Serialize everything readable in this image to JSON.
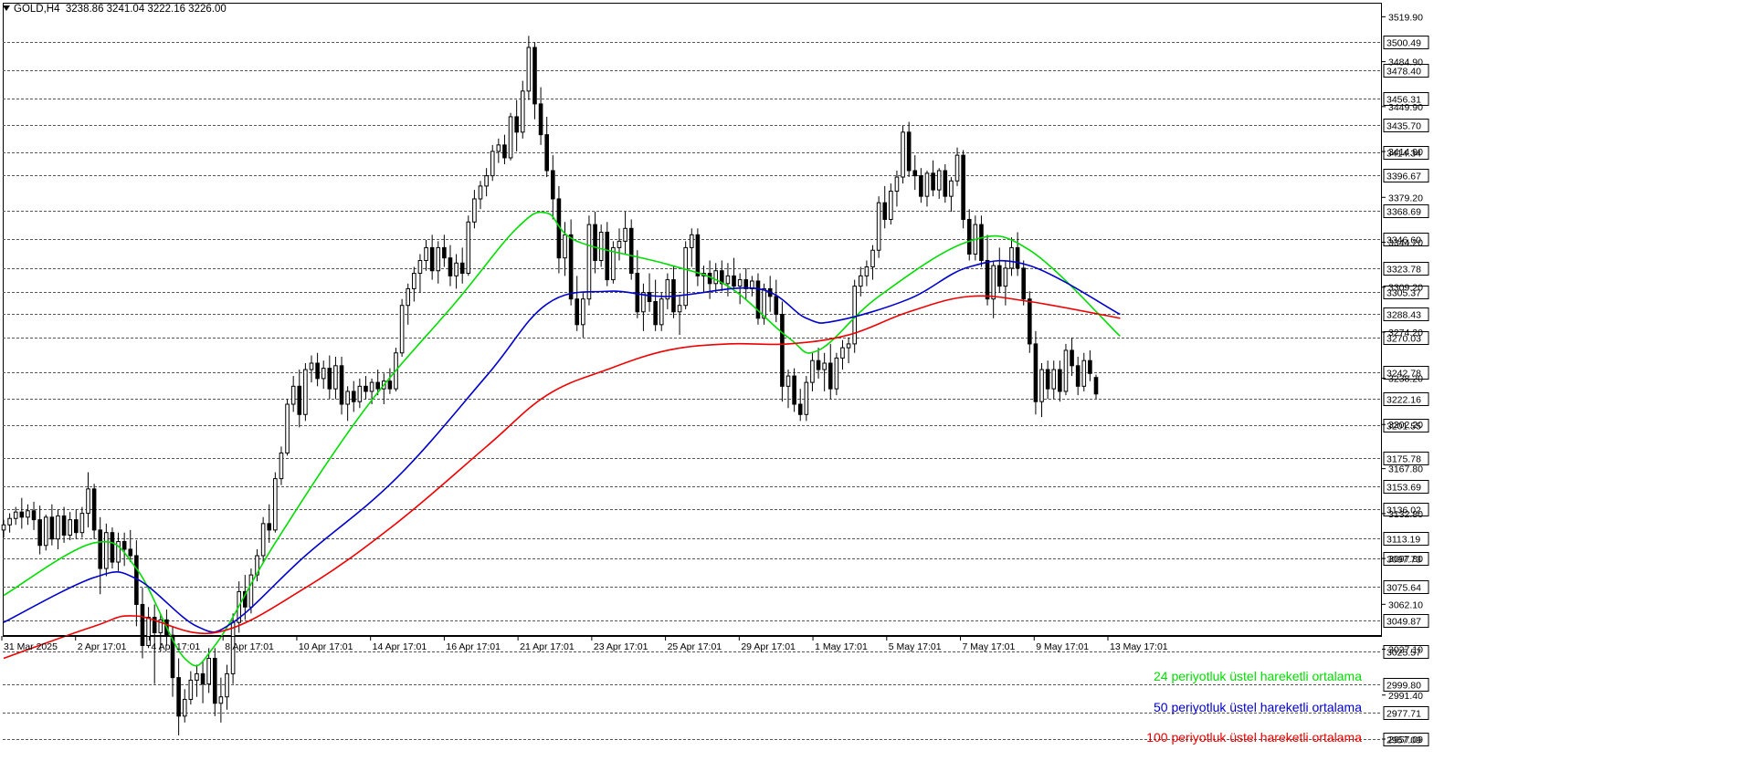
{
  "header": {
    "symbol": "GOLD,H4",
    "ohlc": "3238.86 3241.04 3222.16 3226.00"
  },
  "legend": [
    {
      "label": "24 periyotluk üstel hareketli ortalama",
      "color": "#00dd00"
    },
    {
      "label": "50 periyotluk üstel hareketli ortalama",
      "color": "#0000cc"
    },
    {
      "label": "100 periyotluk üstel hareketli ortalama",
      "color": "#ee0000"
    }
  ],
  "chart_data": {
    "type": "candlestick",
    "instrument": "GOLD",
    "timeframe": "H4",
    "ylim": [
      2950.0,
      3523.0
    ],
    "x_ticks": [
      "31 Mar 2025",
      "2 Apr 17:01",
      "4 Apr 17:01",
      "8 Apr 17:01",
      "10 Apr 17:01",
      "14 Apr 17:01",
      "16 Apr 17:01",
      "21 Apr 17:01",
      "23 Apr 17:01",
      "25 Apr 17:01",
      "29 Apr 17:01",
      "1 May 17:01",
      "5 May 17:01",
      "7 May 17:01",
      "9 May 17:01",
      "13 May 17:01"
    ],
    "y_ticks": [
      3519.9,
      3484.9,
      3449.9,
      3414.9,
      3379.2,
      3344.2,
      3309.2,
      3274.2,
      3238.2,
      3202.2,
      3167.8,
      3132.8,
      3097.8,
      3062.1,
      3027.1,
      2991.4,
      2957.09
    ],
    "price_levels": [
      3500.49,
      3478.4,
      3456.31,
      3435.7,
      3414.34,
      3396.67,
      3368.69,
      3346.6,
      3323.78,
      3305.37,
      3288.43,
      3270.03,
      3242.78,
      3222.16,
      3201.55,
      3175.78,
      3153.69,
      3136.02,
      3113.19,
      3097.73,
      3075.64,
      3049.87,
      3025.57,
      2999.8,
      2977.71,
      2957.09
    ],
    "current_price": 3222.16,
    "candles": [
      [
        3120,
        3128,
        3114,
        3124
      ],
      [
        3124,
        3133,
        3118,
        3129
      ],
      [
        3129,
        3138,
        3124,
        3134
      ],
      [
        3134,
        3145,
        3121,
        3130
      ],
      [
        3130,
        3140,
        3124,
        3135
      ],
      [
        3135,
        3142,
        3120,
        3128
      ],
      [
        3128,
        3139,
        3101,
        3108
      ],
      [
        3108,
        3132,
        3104,
        3130
      ],
      [
        3130,
        3140,
        3108,
        3113
      ],
      [
        3113,
        3136,
        3105,
        3131
      ],
      [
        3131,
        3138,
        3110,
        3116
      ],
      [
        3116,
        3134,
        3112,
        3128
      ],
      [
        3128,
        3136,
        3113,
        3118
      ],
      [
        3118,
        3138,
        3114,
        3133
      ],
      [
        3133,
        3165,
        3122,
        3152
      ],
      [
        3152,
        3156,
        3113,
        3120
      ],
      [
        3120,
        3130,
        3070,
        3090
      ],
      [
        3090,
        3125,
        3084,
        3118
      ],
      [
        3118,
        3122,
        3090,
        3095
      ],
      [
        3095,
        3118,
        3088,
        3111
      ],
      [
        3111,
        3118,
        3092,
        3105
      ],
      [
        3105,
        3120,
        3095,
        3100
      ],
      [
        3100,
        3112,
        3045,
        3062
      ],
      [
        3062,
        3075,
        3020,
        3030
      ],
      [
        3030,
        3060,
        3028,
        3052
      ],
      [
        3052,
        3062,
        3000,
        3040
      ],
      [
        3040,
        3055,
        3025,
        3050
      ],
      [
        3050,
        3058,
        3030,
        3038
      ],
      [
        3038,
        3045,
        2990,
        3005
      ],
      [
        3005,
        3020,
        2960,
        2975
      ],
      [
        2975,
        2996,
        2970,
        2988
      ],
      [
        2988,
        3010,
        2984,
        3003
      ],
      [
        3003,
        3015,
        2990,
        3008
      ],
      [
        3008,
        3018,
        2985,
        3000
      ],
      [
        3000,
        3028,
        2993,
        3020
      ],
      [
        3020,
        3028,
        2975,
        2985
      ],
      [
        2985,
        3005,
        2970,
        2990
      ],
      [
        2990,
        3015,
        2980,
        3008
      ],
      [
        3008,
        3055,
        3000,
        3048
      ],
      [
        3048,
        3080,
        3040,
        3072
      ],
      [
        3072,
        3085,
        3050,
        3060
      ],
      [
        3060,
        3090,
        3055,
        3085
      ],
      [
        3085,
        3105,
        3080,
        3100
      ],
      [
        3100,
        3130,
        3095,
        3125
      ],
      [
        3125,
        3140,
        3110,
        3120
      ],
      [
        3120,
        3165,
        3118,
        3160
      ],
      [
        3160,
        3185,
        3155,
        3180
      ],
      [
        3180,
        3222,
        3178,
        3218
      ],
      [
        3218,
        3240,
        3212,
        3232
      ],
      [
        3232,
        3245,
        3200,
        3210
      ],
      [
        3210,
        3250,
        3205,
        3245
      ],
      [
        3245,
        3256,
        3235,
        3250
      ],
      [
        3250,
        3258,
        3232,
        3238
      ],
      [
        3238,
        3252,
        3230,
        3246
      ],
      [
        3246,
        3256,
        3222,
        3230
      ],
      [
        3230,
        3255,
        3222,
        3248
      ],
      [
        3248,
        3255,
        3210,
        3218
      ],
      [
        3218,
        3232,
        3205,
        3228
      ],
      [
        3228,
        3236,
        3212,
        3220
      ],
      [
        3220,
        3238,
        3215,
        3232
      ],
      [
        3232,
        3240,
        3222,
        3228
      ],
      [
        3228,
        3238,
        3218,
        3235
      ],
      [
        3235,
        3245,
        3225,
        3230
      ],
      [
        3230,
        3242,
        3218,
        3236
      ],
      [
        3236,
        3246,
        3226,
        3230
      ],
      [
        3230,
        3262,
        3228,
        3258
      ],
      [
        3258,
        3300,
        3255,
        3295
      ],
      [
        3295,
        3312,
        3280,
        3308
      ],
      [
        3308,
        3325,
        3298,
        3320
      ],
      [
        3320,
        3335,
        3305,
        3330
      ],
      [
        3330,
        3346,
        3322,
        3340
      ],
      [
        3340,
        3350,
        3315,
        3322
      ],
      [
        3322,
        3345,
        3312,
        3340
      ],
      [
        3340,
        3350,
        3325,
        3332
      ],
      [
        3332,
        3342,
        3310,
        3318
      ],
      [
        3318,
        3335,
        3308,
        3328
      ],
      [
        3328,
        3340,
        3312,
        3320
      ],
      [
        3320,
        3365,
        3318,
        3360
      ],
      [
        3360,
        3385,
        3355,
        3378
      ],
      [
        3378,
        3392,
        3370,
        3388
      ],
      [
        3388,
        3402,
        3380,
        3396
      ],
      [
        3396,
        3420,
        3392,
        3415
      ],
      [
        3415,
        3425,
        3406,
        3420
      ],
      [
        3420,
        3428,
        3405,
        3410
      ],
      [
        3410,
        3445,
        3408,
        3442
      ],
      [
        3442,
        3455,
        3415,
        3430
      ],
      [
        3430,
        3470,
        3425,
        3462
      ],
      [
        3462,
        3505,
        3455,
        3496
      ],
      [
        3496,
        3500,
        3440,
        3452
      ],
      [
        3452,
        3465,
        3420,
        3428
      ],
      [
        3428,
        3442,
        3395,
        3400
      ],
      [
        3400,
        3412,
        3362,
        3378
      ],
      [
        3378,
        3388,
        3320,
        3332
      ],
      [
        3332,
        3360,
        3318,
        3350
      ],
      [
        3350,
        3362,
        3295,
        3300
      ],
      [
        3300,
        3318,
        3275,
        3280
      ],
      [
        3280,
        3305,
        3270,
        3300
      ],
      [
        3300,
        3365,
        3295,
        3358
      ],
      [
        3358,
        3368,
        3320,
        3330
      ],
      [
        3330,
        3358,
        3325,
        3352
      ],
      [
        3352,
        3360,
        3310,
        3315
      ],
      [
        3315,
        3345,
        3312,
        3340
      ],
      [
        3340,
        3355,
        3330,
        3345
      ],
      [
        3345,
        3368,
        3335,
        3355
      ],
      [
        3355,
        3362,
        3315,
        3320
      ],
      [
        3320,
        3338,
        3285,
        3290
      ],
      [
        3290,
        3312,
        3275,
        3305
      ],
      [
        3305,
        3320,
        3290,
        3298
      ],
      [
        3298,
        3315,
        3275,
        3280
      ],
      [
        3280,
        3305,
        3275,
        3300
      ],
      [
        3300,
        3320,
        3292,
        3315
      ],
      [
        3315,
        3326,
        3285,
        3290
      ],
      [
        3290,
        3302,
        3272,
        3295
      ],
      [
        3295,
        3345,
        3292,
        3340
      ],
      [
        3340,
        3355,
        3325,
        3350
      ],
      [
        3350,
        3355,
        3310,
        3318
      ],
      [
        3318,
        3326,
        3305,
        3320
      ],
      [
        3320,
        3330,
        3300,
        3312
      ],
      [
        3312,
        3328,
        3305,
        3322
      ],
      [
        3322,
        3330,
        3306,
        3312
      ],
      [
        3312,
        3328,
        3302,
        3318
      ],
      [
        3318,
        3332,
        3306,
        3310
      ],
      [
        3310,
        3320,
        3296,
        3315
      ],
      [
        3315,
        3324,
        3300,
        3308
      ],
      [
        3308,
        3318,
        3302,
        3314
      ],
      [
        3314,
        3320,
        3280,
        3285
      ],
      [
        3285,
        3312,
        3280,
        3308
      ],
      [
        3308,
        3318,
        3290,
        3302
      ],
      [
        3302,
        3315,
        3282,
        3288
      ],
      [
        3288,
        3298,
        3220,
        3232
      ],
      [
        3232,
        3245,
        3215,
        3240
      ],
      [
        3240,
        3246,
        3212,
        3218
      ],
      [
        3218,
        3230,
        3205,
        3210
      ],
      [
        3210,
        3240,
        3205,
        3235
      ],
      [
        3235,
        3258,
        3228,
        3252
      ],
      [
        3252,
        3262,
        3238,
        3245
      ],
      [
        3245,
        3258,
        3228,
        3250
      ],
      [
        3250,
        3265,
        3222,
        3230
      ],
      [
        3230,
        3258,
        3225,
        3254
      ],
      [
        3254,
        3268,
        3245,
        3262
      ],
      [
        3262,
        3270,
        3250,
        3265
      ],
      [
        3265,
        3315,
        3258,
        3310
      ],
      [
        3310,
        3325,
        3302,
        3318
      ],
      [
        3318,
        3330,
        3310,
        3325
      ],
      [
        3325,
        3342,
        3315,
        3338
      ],
      [
        3338,
        3380,
        3332,
        3375
      ],
      [
        3375,
        3388,
        3355,
        3362
      ],
      [
        3362,
        3390,
        3358,
        3384
      ],
      [
        3384,
        3400,
        3372,
        3395
      ],
      [
        3395,
        3435,
        3390,
        3430
      ],
      [
        3430,
        3438,
        3395,
        3400
      ],
      [
        3400,
        3412,
        3385,
        3396
      ],
      [
        3396,
        3402,
        3375,
        3380
      ],
      [
        3380,
        3400,
        3372,
        3398
      ],
      [
        3398,
        3408,
        3380,
        3385
      ],
      [
        3385,
        3402,
        3378,
        3400
      ],
      [
        3400,
        3405,
        3375,
        3380
      ],
      [
        3380,
        3395,
        3368,
        3392
      ],
      [
        3392,
        3418,
        3388,
        3412
      ],
      [
        3412,
        3416,
        3355,
        3362
      ],
      [
        3362,
        3370,
        3330,
        3335
      ],
      [
        3335,
        3365,
        3330,
        3358
      ],
      [
        3358,
        3365,
        3325,
        3330
      ],
      [
        3330,
        3350,
        3295,
        3300
      ],
      [
        3300,
        3330,
        3285,
        3326
      ],
      [
        3326,
        3340,
        3305,
        3310
      ],
      [
        3310,
        3330,
        3295,
        3324
      ],
      [
        3324,
        3348,
        3318,
        3340
      ],
      [
        3340,
        3352,
        3318,
        3324
      ],
      [
        3324,
        3330,
        3295,
        3300
      ],
      [
        3300,
        3306,
        3258,
        3265
      ],
      [
        3265,
        3275,
        3210,
        3220
      ],
      [
        3220,
        3250,
        3208,
        3245
      ],
      [
        3245,
        3252,
        3222,
        3230
      ],
      [
        3230,
        3252,
        3222,
        3245
      ],
      [
        3245,
        3252,
        3220,
        3228
      ],
      [
        3228,
        3265,
        3225,
        3260
      ],
      [
        3260,
        3270,
        3240,
        3248
      ],
      [
        3248,
        3255,
        3225,
        3232
      ],
      [
        3232,
        3258,
        3228,
        3252
      ],
      [
        3252,
        3260,
        3236,
        3242
      ],
      [
        3238.86,
        3241.04,
        3222.16,
        3226.0
      ]
    ],
    "series": [
      {
        "name": "24 periyotluk üstel hareketli ortalama",
        "color": "#00dd00",
        "period": 24,
        "points": [
          [
            0,
            3069
          ],
          [
            15,
            3110
          ],
          [
            22,
            3090
          ],
          [
            30,
            3020
          ],
          [
            35,
            3030
          ],
          [
            45,
            3110
          ],
          [
            60,
            3215
          ],
          [
            75,
            3298
          ],
          [
            85,
            3355
          ],
          [
            90,
            3367
          ],
          [
            95,
            3345
          ],
          [
            110,
            3327
          ],
          [
            120,
            3310
          ],
          [
            130,
            3270
          ],
          [
            135,
            3260
          ],
          [
            145,
            3302
          ],
          [
            160,
            3345
          ],
          [
            170,
            3338
          ],
          [
            185,
            3271
          ]
        ]
      },
      {
        "name": "50 periyotluk üstel hareketli ortalama",
        "color": "#0000cc",
        "period": 50,
        "points": [
          [
            0,
            3048
          ],
          [
            15,
            3083
          ],
          [
            22,
            3082
          ],
          [
            32,
            3045
          ],
          [
            38,
            3048
          ],
          [
            50,
            3100
          ],
          [
            65,
            3160
          ],
          [
            80,
            3240
          ],
          [
            90,
            3296
          ],
          [
            100,
            3306
          ],
          [
            110,
            3302
          ],
          [
            125,
            3308
          ],
          [
            133,
            3285
          ],
          [
            138,
            3283
          ],
          [
            150,
            3300
          ],
          [
            160,
            3325
          ],
          [
            170,
            3326
          ],
          [
            185,
            3288
          ]
        ]
      },
      {
        "name": "100 periyotluk üstel hareketli ortalama",
        "color": "#ee0000",
        "period": 100,
        "points": [
          [
            0,
            3020
          ],
          [
            15,
            3045
          ],
          [
            22,
            3053
          ],
          [
            35,
            3040
          ],
          [
            50,
            3075
          ],
          [
            65,
            3125
          ],
          [
            80,
            3185
          ],
          [
            90,
            3225
          ],
          [
            100,
            3245
          ],
          [
            110,
            3260
          ],
          [
            120,
            3265
          ],
          [
            130,
            3265
          ],
          [
            140,
            3272
          ],
          [
            150,
            3290
          ],
          [
            160,
            3302
          ],
          [
            170,
            3298
          ],
          [
            185,
            3285
          ]
        ]
      }
    ]
  }
}
